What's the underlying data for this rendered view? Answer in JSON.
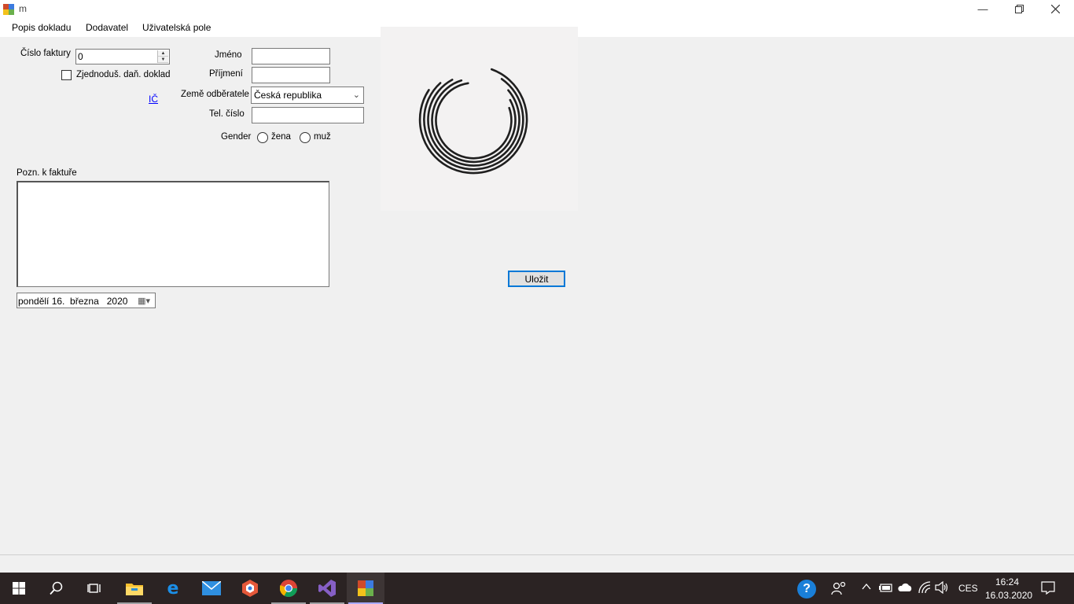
{
  "window": {
    "title": "m"
  },
  "menu": {
    "items": [
      "Popis dokladu",
      "Dodavatel",
      "Uživatelská pole"
    ]
  },
  "form": {
    "invoice_number_label": "Číslo faktury",
    "invoice_number_value": "0",
    "simplified_doc_label": "Zjednoduš. daň. doklad",
    "ic_link": "IČ",
    "first_name_label": "Jméno",
    "first_name_value": "",
    "last_name_label": "Příjmení",
    "last_name_value": "",
    "country_label": "Země odběratele",
    "country_value": "Česká republika",
    "phone_label": "Tel. číslo",
    "phone_value": "",
    "gender_label": "Gender",
    "gender_options": [
      "žena",
      "muž"
    ],
    "notes_label": "Pozn. k faktuře",
    "notes_value": "",
    "date_value": "pondělí 16.  března   2020",
    "save_label": "Uložit"
  },
  "taskbar": {
    "apps": [
      "start",
      "search",
      "task-view",
      "file-explorer",
      "edge",
      "mail",
      "app-hex",
      "chrome",
      "visual-studio",
      "winforms-app"
    ],
    "language": "CES",
    "time": "16:24",
    "date": "16.03.2020"
  },
  "colors": {
    "accent": "#0078d7",
    "taskbar": "#2b2323",
    "link": "#0000ff"
  }
}
